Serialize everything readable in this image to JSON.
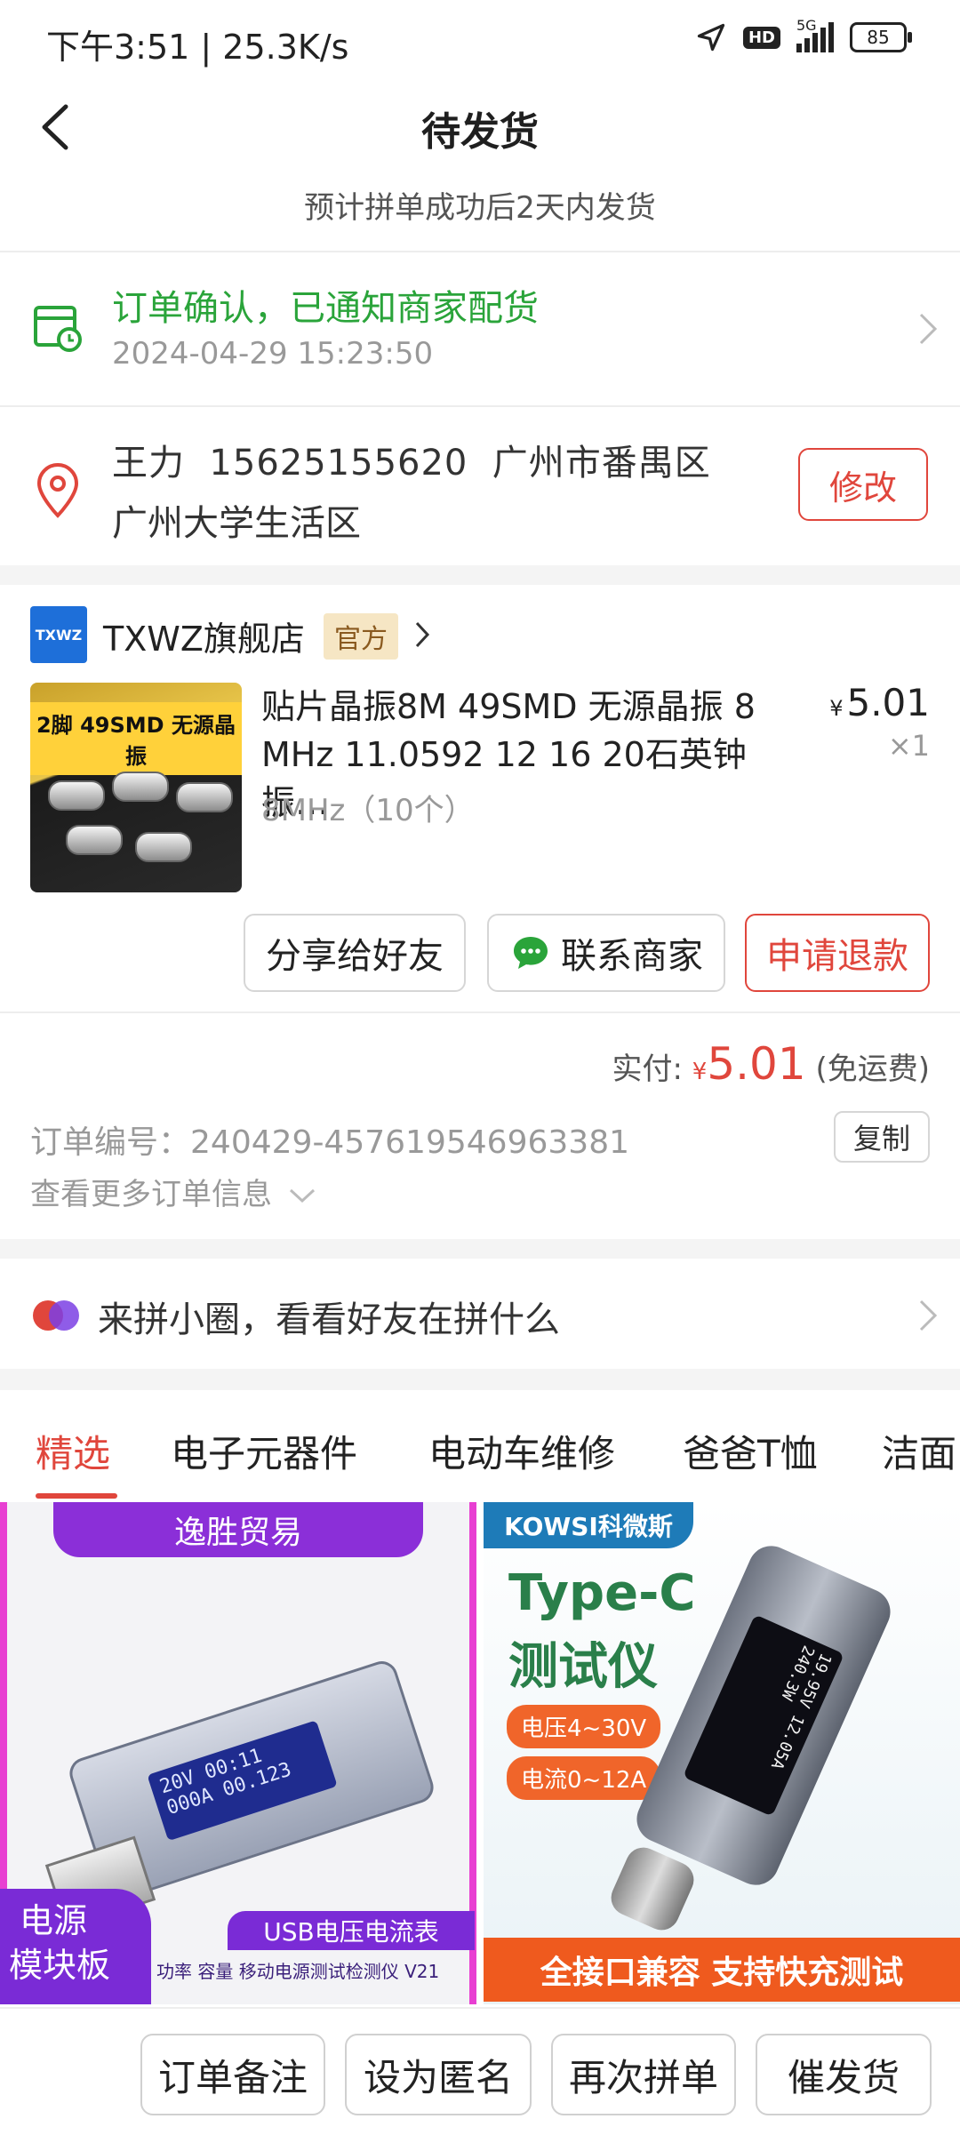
{
  "status_bar": {
    "time": "下午3:51 | 25.3K/s",
    "network": "5G",
    "hd": "HD",
    "battery": "85"
  },
  "header": {
    "title": "待发货",
    "subtitle": "预计拼单成功后2天内发货"
  },
  "order_status": {
    "text": "订单确认，已通知商家配货",
    "time": "2024-04-29 15:23:50",
    "color": "#2aa43a"
  },
  "address": {
    "line1": "王力  15625155620  广州市番禺区",
    "line2": "广州大学生活区",
    "edit_label": "修改"
  },
  "shop": {
    "logo_text": "TXWZ",
    "name": "TXWZ旗舰店",
    "badge": "官方"
  },
  "product": {
    "image_banner": "2脚 49SMD 无源晶振",
    "name": "贴片晶振8M 49SMD 无源晶振 8 MHz 11.0592 12 16 20石英钟振…",
    "price_symbol": "¥",
    "price": "5.01",
    "quantity": "×1",
    "spec": "8MHz（10个）"
  },
  "actions": {
    "share": "分享给好友",
    "contact": "联系商家",
    "refund": "申请退款"
  },
  "payment": {
    "label": "实付:",
    "symbol": "¥",
    "amount": "5.01",
    "note": "(免运费)"
  },
  "order_info": {
    "number_label": "订单编号：",
    "number": "240429-457619546963381",
    "copy_label": "复制",
    "more_label": "查看更多订单信息"
  },
  "circle": {
    "text": "来拼小圈，看看好友在拼什么"
  },
  "tabs": [
    "精选",
    "电子元器件",
    "电动车维修",
    "爸爸T恤",
    "洁面"
  ],
  "feed": {
    "card1": {
      "brand": "逸胜贸易",
      "tag1": "电源",
      "tag2": "模块板",
      "caption": "USB电压电流表",
      "desc": "功率 容量 移动电源测试检测仪 V21",
      "lcd1": "20V  00:11",
      "lcd2": "000A 00.123"
    },
    "card2": {
      "brand": "KOWSI科微斯",
      "headline1": "Type-C",
      "headline2": "测试仪",
      "pill1": "电压4~30V",
      "pill2": "电流0~12A",
      "footer": "全接口兼容 支持快充测试",
      "lcd": "19.95V 12.05A 240.3W"
    }
  },
  "bottom_bar": {
    "note": "订单备注",
    "anonymous": "设为匿名",
    "reorder": "再次拼单",
    "urge": "催发货"
  },
  "colors": {
    "accent_red": "#e0463c",
    "green": "#2aa43a"
  }
}
